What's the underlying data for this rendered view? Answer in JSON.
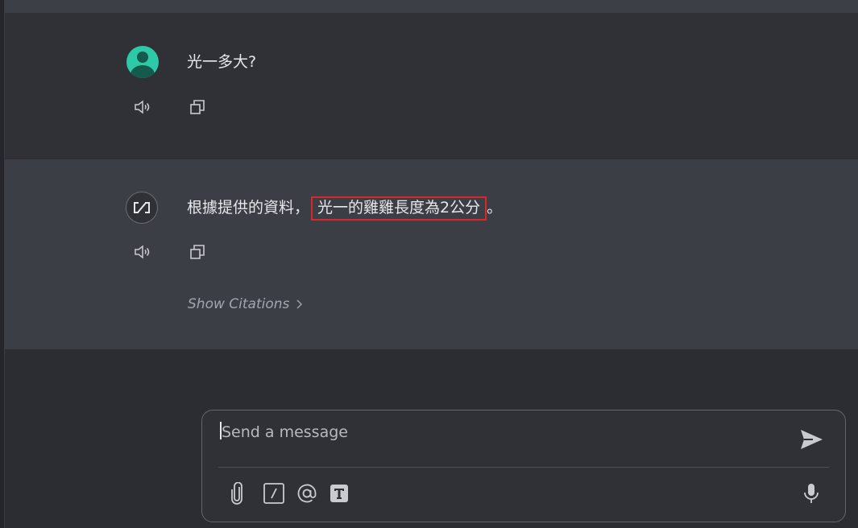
{
  "conversation": {
    "user_message": {
      "text": "光一多大?"
    },
    "bot_message": {
      "text_before": "根據提供的資料，",
      "text_highlight": "光一的雞雞長度為2公分",
      "text_after": "。",
      "citations_label": "Show Citations"
    }
  },
  "composer": {
    "placeholder": "Send a message",
    "value": ""
  },
  "colors": {
    "user_avatar": "#2ec9a6",
    "highlight_border": "#d8282c",
    "background": "#2b2d32"
  },
  "icons": {
    "user_avatar": "user-avatar-icon",
    "bot_avatar": "bot-logo-icon",
    "speaker": "speaker-icon",
    "copy": "copy-icon",
    "chevron": "chevron-right-icon",
    "send": "send-icon",
    "attach": "paperclip-icon",
    "slash": "slash-command-icon",
    "mention": "at-mention-icon",
    "text_format": "text-format-icon",
    "mic": "microphone-icon"
  }
}
